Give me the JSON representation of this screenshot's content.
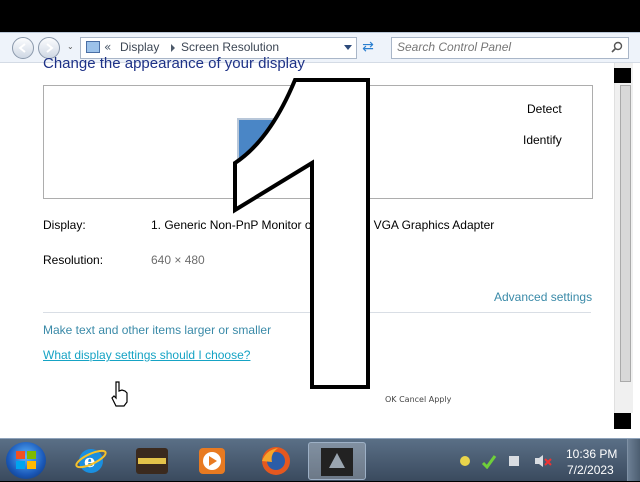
{
  "address_bar": {
    "recent_glyph": "⌄",
    "more_glyph": "«",
    "crumbs": [
      "Display",
      "Screen Resolution"
    ],
    "search_placeholder": "Search Control Panel"
  },
  "page": {
    "title": "Change the appearance of your display",
    "detect": "Detect",
    "identify": "Identify",
    "display_label": "Display:",
    "display_value": "1. Generic Non-PnP Monitor on Standard VGA Graphics Adapter",
    "resolution_label": "Resolution:",
    "resolution_value": "640 × 480",
    "advanced_link": "Advanced settings",
    "text_size_link": "Make text and other items larger or smaller",
    "help_link": "What display settings should I choose?",
    "footer_text": "OK    Cancel    Apply"
  },
  "overlay": {
    "big_digit": "1"
  },
  "taskbar": {
    "apps": [
      "internet-explorer-icon",
      "app-icon",
      "media-player-icon",
      "firefox-icon",
      "active-app-icon"
    ],
    "clock_time": "10:36 PM",
    "clock_date": "7/2/2023"
  },
  "colors": {
    "title": "#1e3287",
    "link": "#3a8aa8",
    "help_link": "#16a3c4",
    "taskbar": "#3a4a5e"
  }
}
